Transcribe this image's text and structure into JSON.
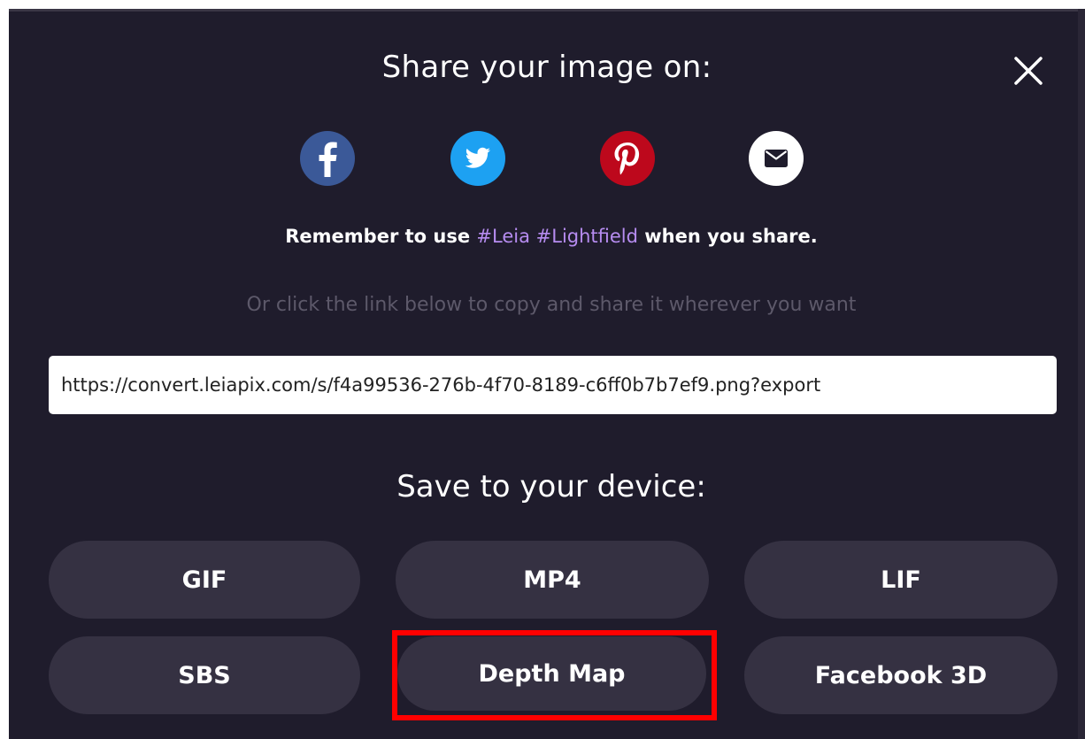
{
  "dialog": {
    "share_title": "Share your image on:",
    "remember": {
      "prefix": "Remember to use ",
      "hashtags": "#Leia #Lightfield",
      "suffix": " when you share."
    },
    "copy_hint": "Or click the link below to copy and share it wherever you want",
    "share_link": "https://convert.leiapix.com/s/f4a99536-276b-4f70-8189-c6ff0b7b7ef9.png?export",
    "save_title": "Save to your device:"
  },
  "social": [
    {
      "name": "facebook",
      "icon": "facebook-icon",
      "color": "#3b5998"
    },
    {
      "name": "twitter",
      "icon": "twitter-icon",
      "color": "#1da1f2"
    },
    {
      "name": "pinterest",
      "icon": "pinterest-icon",
      "color": "#bd081c"
    },
    {
      "name": "email",
      "icon": "email-icon",
      "color": "#ffffff"
    }
  ],
  "buttons": {
    "gif": "GIF",
    "mp4": "MP4",
    "lif": "LIF",
    "sbs": "SBS",
    "depth_map": "Depth Map",
    "facebook_3d": "Facebook 3D"
  },
  "colors": {
    "background": "#1f1c2c",
    "button": "#353142",
    "hashtag": "#b68cf0",
    "highlight": "#ff0000"
  },
  "icons": {
    "close": "close-icon"
  }
}
